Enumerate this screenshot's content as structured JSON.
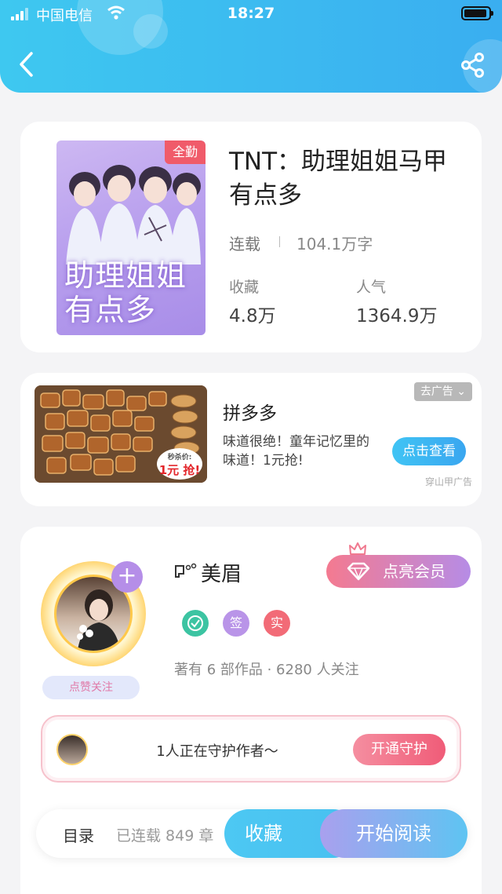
{
  "status_bar": {
    "carrier": "中国电信",
    "time": "18:27"
  },
  "nav": {
    "back_icon": "chevron-left-icon",
    "share_icon": "share-icon"
  },
  "book": {
    "cover_badge": "全勤",
    "cover_title": "助理姐姐有点多",
    "title": "TNT：助理姐姐马甲有点多",
    "status": "连载",
    "word_count": "104.1万字",
    "favorites_label": "收藏",
    "favorites_value": "4.8万",
    "popularity_label": "人气",
    "popularity_value": "1364.9万"
  },
  "ad": {
    "remove_label": "去广告",
    "price_small": "秒杀价:",
    "price": "1元 抢!",
    "title": "拼多多",
    "description": "味道很绝！童年记忆里的味道！1元抢!",
    "button_label": "点击查看",
    "source": "穿山甲广告"
  },
  "author": {
    "name": "美眉",
    "vip_label": "点亮会员",
    "badges": [
      {
        "label": "",
        "icon": "medal-icon",
        "color": "#3cc4a2"
      },
      {
        "label": "签",
        "color": "#b994e8"
      },
      {
        "label": "实",
        "color": "#f26b77"
      }
    ],
    "meta": "著有 6 部作品 · 6280 人关注",
    "like_follow": "点赞关注",
    "guard_text": "1人正在守护作者～",
    "guard_button": "开通守护"
  },
  "bottom_bar": {
    "toc_label": "目录",
    "chapters": "已连载 849 章",
    "favorite_label": "收藏",
    "read_label": "开始阅读"
  },
  "colors": {
    "header": "#3ec8f0",
    "accent": "#3aa6f0",
    "vip_pink": "#f47a90"
  }
}
